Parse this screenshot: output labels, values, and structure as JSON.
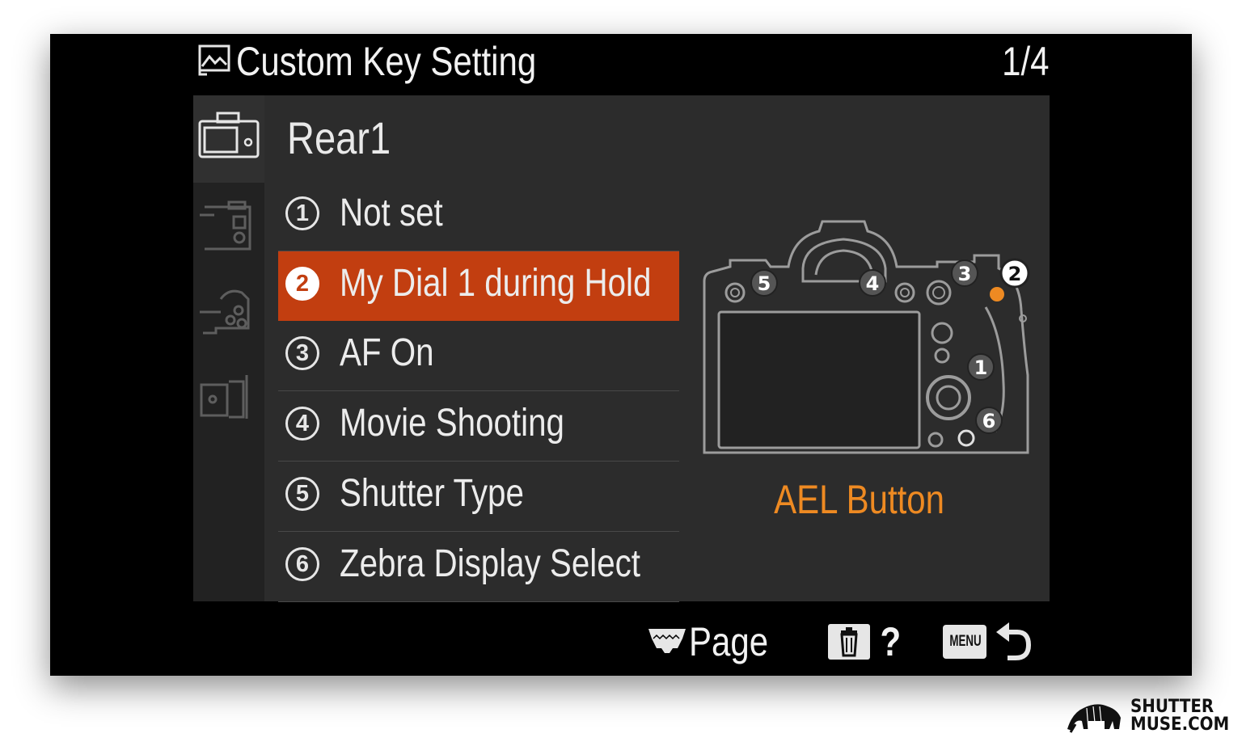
{
  "header": {
    "title": "Custom Key Setting",
    "page_indicator": "1/4",
    "icon": "photo-mode-icon"
  },
  "sidebar": {
    "tabs": [
      {
        "icon": "camera-rear-icon",
        "active": true
      },
      {
        "icon": "camera-top-icon",
        "active": false
      },
      {
        "icon": "camera-front-icon",
        "active": false
      },
      {
        "icon": "camera-side-icon",
        "active": false
      }
    ]
  },
  "group": {
    "title": "Rear1"
  },
  "items": [
    {
      "num": "1",
      "label": "Not set",
      "selected": false
    },
    {
      "num": "2",
      "label": "My Dial 1 during Hold",
      "selected": true
    },
    {
      "num": "3",
      "label": "AF On",
      "selected": false
    },
    {
      "num": "4",
      "label": "Movie Shooting",
      "selected": false
    },
    {
      "num": "5",
      "label": "Shutter Type",
      "selected": false
    },
    {
      "num": "6",
      "label": "Zebra Display Select",
      "selected": false
    }
  ],
  "diagram": {
    "button_label": "AEL Button",
    "markers": [
      "5",
      "4",
      "3",
      "2",
      "1",
      "6"
    ]
  },
  "footer": {
    "page_label": "Page",
    "help_label": "?",
    "menu_key_label": "MENU"
  },
  "branding": {
    "line1": "SHUTTER",
    "line2": "MUSE.COM"
  },
  "colors": {
    "selected": "#c23e10",
    "accent_label": "#ee8a22",
    "panel": "#2c2c2c",
    "sidebar": "#222222",
    "screen": "#000000"
  }
}
